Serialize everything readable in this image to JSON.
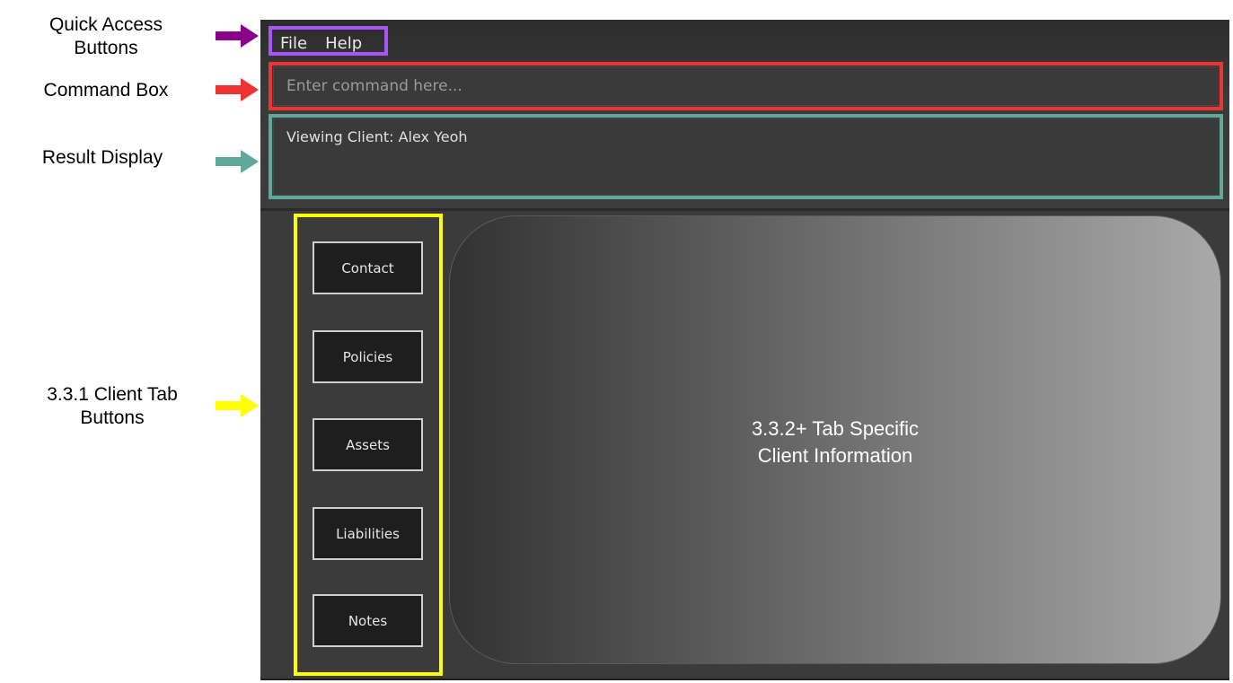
{
  "annotations": {
    "quick_access": "Quick Access\nButtons",
    "command_box": "Command Box",
    "result_display": "Result Display",
    "client_tabs": "3.3.1 Client Tab\nButtons",
    "tab_info": "3.3.2+ Tab Specific\nClient Information"
  },
  "menu": {
    "file": "File",
    "help": "Help"
  },
  "command": {
    "placeholder": "Enter command here..."
  },
  "result": {
    "text": "Viewing Client: Alex Yeoh"
  },
  "tabs": [
    {
      "label": "Contact"
    },
    {
      "label": "Policies"
    },
    {
      "label": "Assets"
    },
    {
      "label": "Liabilities"
    },
    {
      "label": "Notes"
    }
  ],
  "colors": {
    "quick_access": "#a855f7",
    "command_box": "#ef3333",
    "result_display": "#5fa89a",
    "client_tabs": "#ffff00",
    "quick_access_arrow": "#8b008b"
  }
}
